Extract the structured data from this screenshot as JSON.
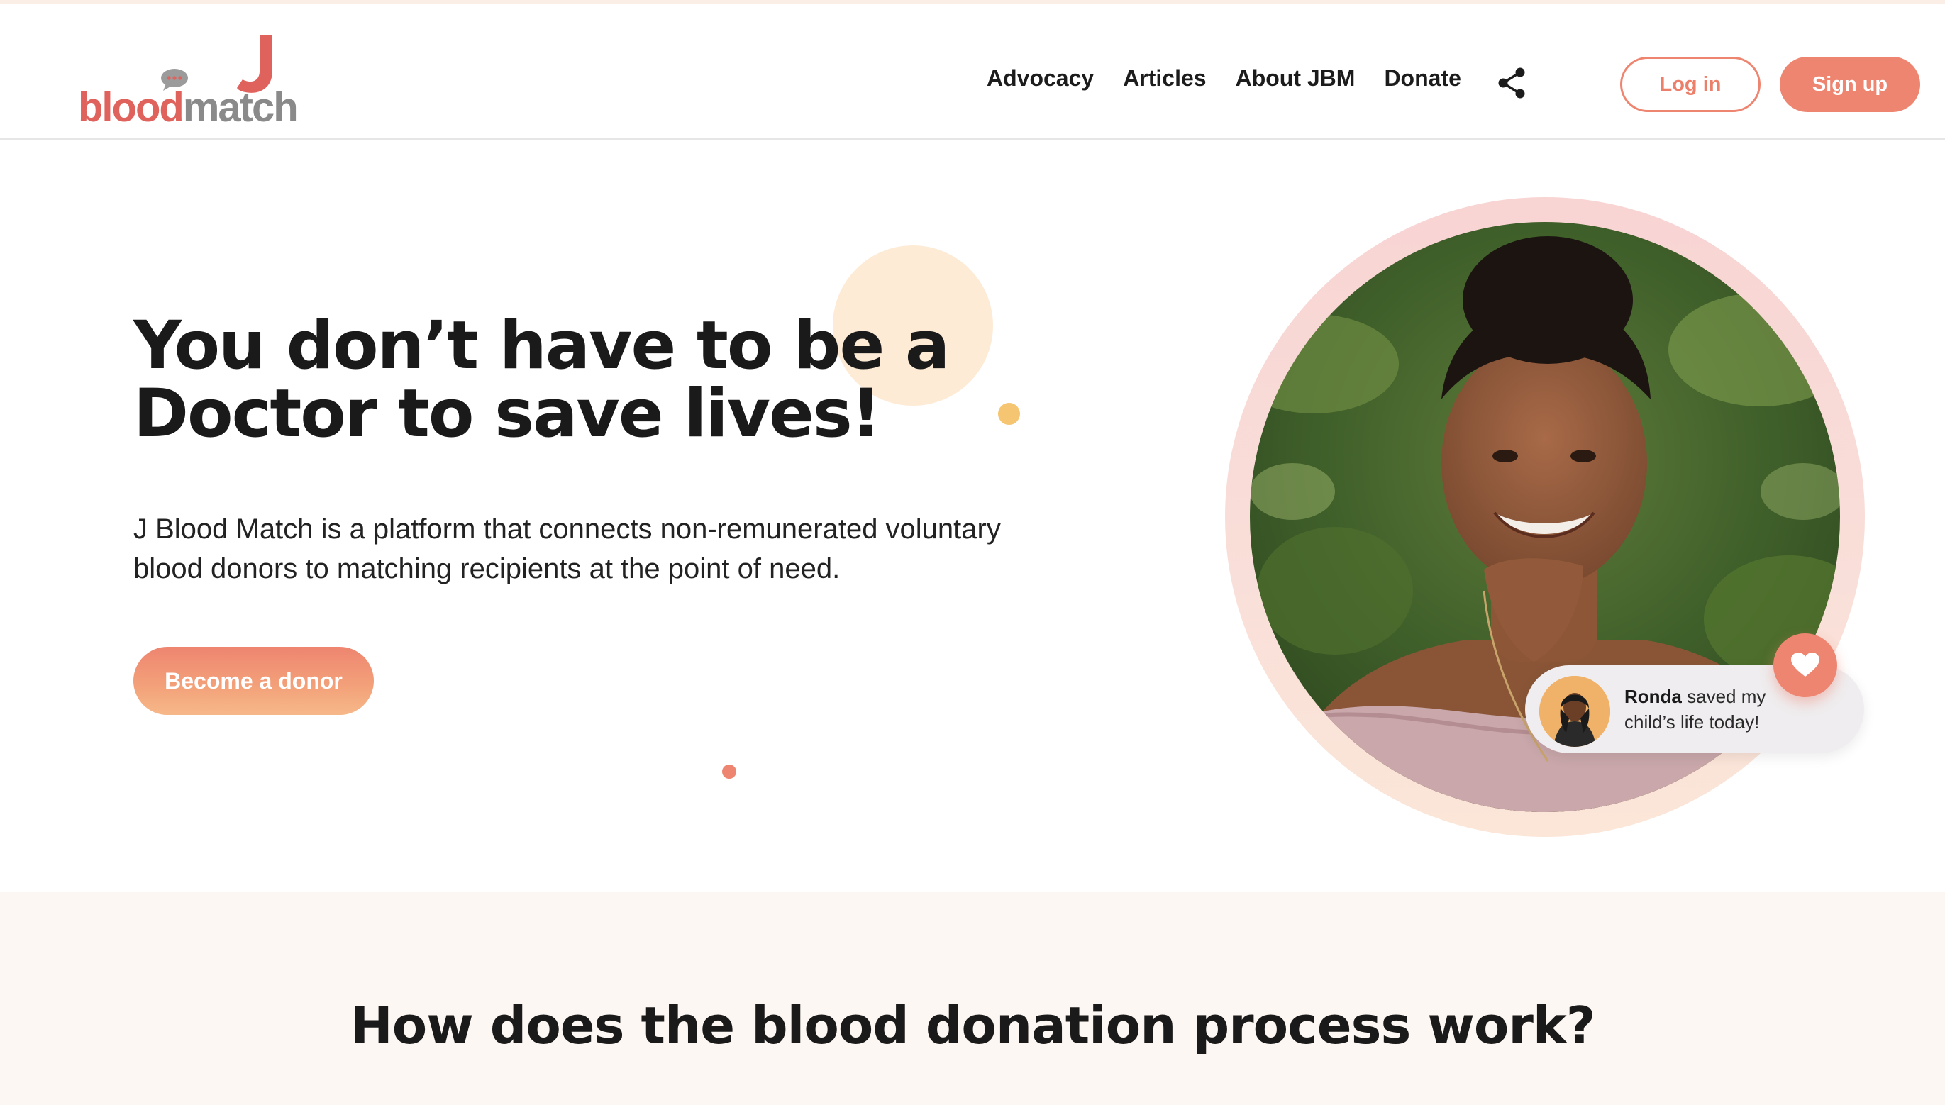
{
  "brand": {
    "logo_text_part1": "blood",
    "logo_text_part2": "match",
    "colors": {
      "primary": "#ee8570",
      "logo_red": "#e0625c",
      "logo_gray": "#8a8a8a",
      "accent_yellow": "#f6c571",
      "soft_peach": "#fdebd6",
      "section_bg": "#fdf7f3"
    }
  },
  "nav": {
    "items": [
      {
        "label": "Advocacy"
      },
      {
        "label": "Articles"
      },
      {
        "label": "About JBM"
      },
      {
        "label": "Donate"
      }
    ],
    "share_icon": "share-icon",
    "login_label": "Log in",
    "signup_label": "Sign up"
  },
  "hero": {
    "title_line1": "You don’t have to be a",
    "title_line2": "Doctor to save lives!",
    "description_line1": "J Blood Match is a platform that connects non-remunerated voluntary",
    "description_line2": "blood donors to matching recipients at the point of need.",
    "cta_label": "Become a donor"
  },
  "testimonial": {
    "name": "Ronda",
    "text_after_name": " saved my",
    "text_line2": "child’s life today!",
    "badge_icon": "heart-icon"
  },
  "process": {
    "title": "How does the blood donation process work?"
  }
}
